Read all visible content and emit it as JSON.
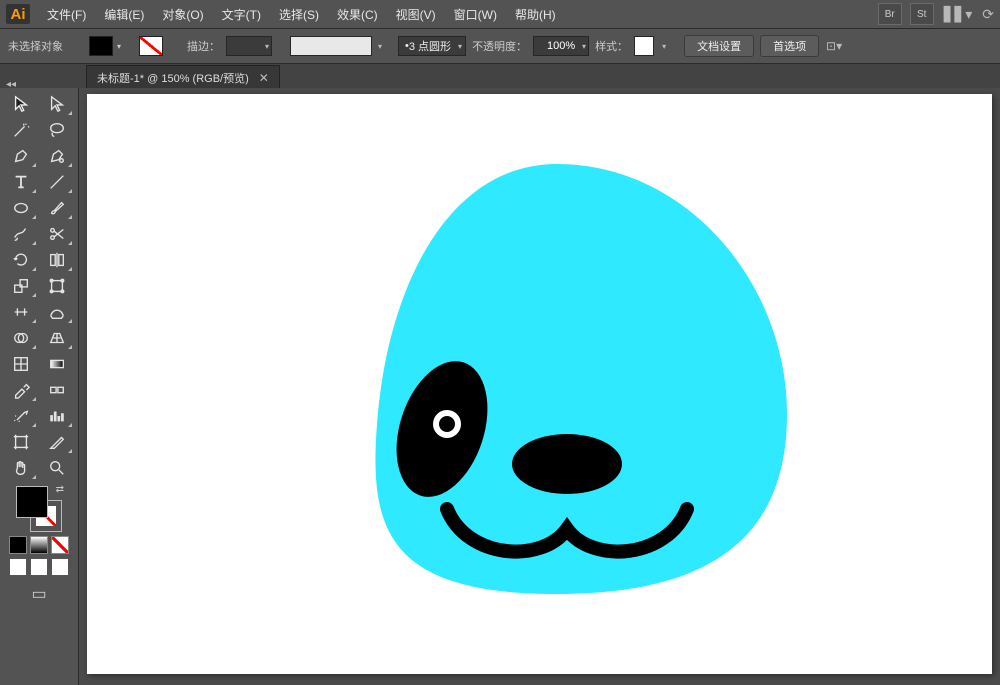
{
  "app": {
    "logo_text": "Ai"
  },
  "menu": {
    "items": [
      "文件(F)",
      "编辑(E)",
      "对象(O)",
      "文字(T)",
      "选择(S)",
      "效果(C)",
      "视图(V)",
      "窗口(W)",
      "帮助(H)"
    ],
    "right_icons": [
      "Br",
      "St"
    ]
  },
  "ctrl": {
    "selection_status": "未选择对象",
    "stroke_label": "描边：",
    "brush_label": "3 点圆形",
    "opacity_label": "不透明度：",
    "opacity_value": "100%",
    "style_label": "样式：",
    "doc_setup": "文档设置",
    "prefs": "首选项"
  },
  "tab": {
    "title": "未标题-1* @ 150% (RGB/预览)",
    "close": "✕"
  },
  "tools": {
    "names": [
      "selection",
      "direct-selection",
      "magic-wand",
      "lasso",
      "pen",
      "add-anchor",
      "type",
      "line-segment",
      "ellipse",
      "paintbrush",
      "pencil",
      "scissors",
      "rotate",
      "reflect",
      "scale",
      "free-transform",
      "width",
      "warp",
      "shape-builder",
      "perspective",
      "mesh",
      "gradient",
      "eyedropper",
      "blend",
      "symbol-sprayer",
      "column-graph",
      "artboard",
      "slice",
      "hand",
      "zoom"
    ]
  },
  "colors": {
    "body": "#2EE9FF",
    "face": "#000000"
  }
}
